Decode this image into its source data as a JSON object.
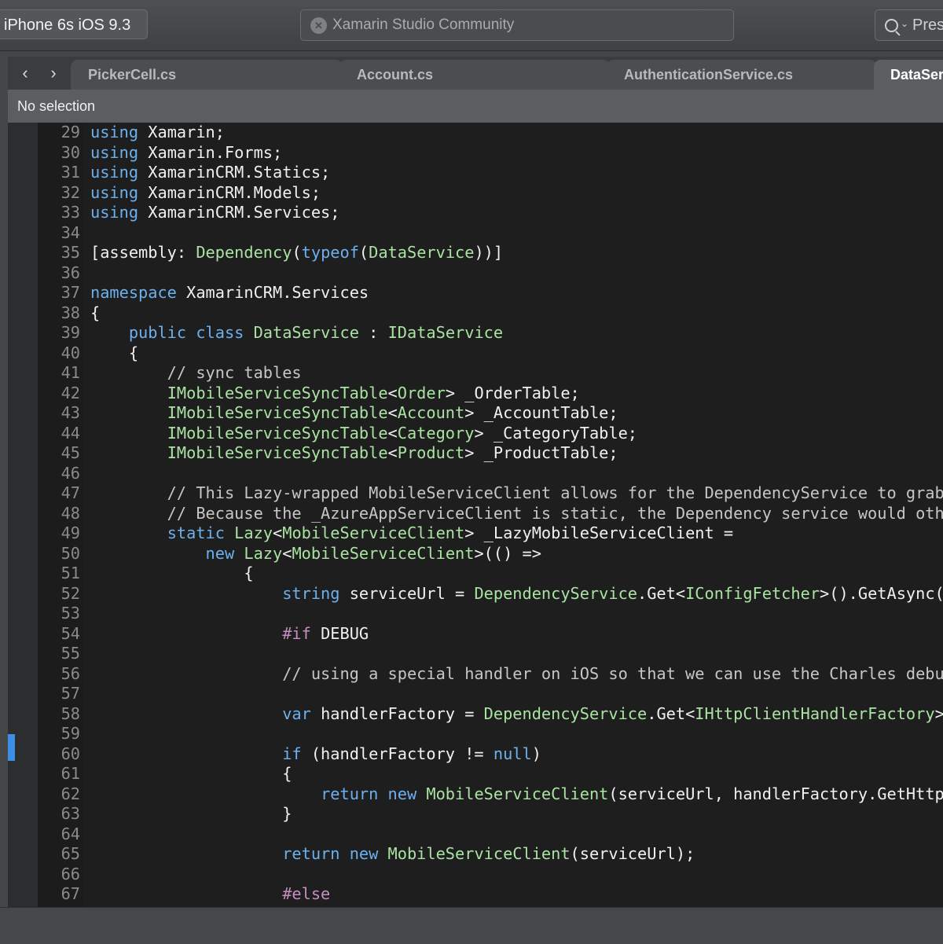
{
  "toolbar": {
    "device": "iPhone 6s iOS 9.3",
    "status": "Xamarin Studio Community",
    "search_placeholder": "Pres",
    "logo_icon": "xamarin-logo-icon"
  },
  "nav": {
    "back": "‹",
    "forward": "›"
  },
  "tabs": [
    {
      "label": "PickerCell.cs",
      "active": false
    },
    {
      "label": "Account.cs",
      "active": false
    },
    {
      "label": "AuthenticationService.cs",
      "active": false
    },
    {
      "label": "DataService.cs",
      "active": true
    }
  ],
  "breadcrumb": {
    "label": "No selection"
  },
  "colors": {
    "keyword": "#6cb0ee",
    "type": "#a9e3a2",
    "comment": "#c6c6c6",
    "preprocessor": "#c58ec2",
    "breakpoint_marker": "#3d8fe6"
  },
  "code": [
    {
      "n": "29",
      "tokens": [
        [
          "kw",
          "using"
        ],
        [
          "tx",
          " Xamarin;"
        ]
      ]
    },
    {
      "n": "30",
      "tokens": [
        [
          "kw",
          "using"
        ],
        [
          "tx",
          " Xamarin.Forms;"
        ]
      ]
    },
    {
      "n": "31",
      "tokens": [
        [
          "kw",
          "using"
        ],
        [
          "tx",
          " XamarinCRM.Statics;"
        ]
      ]
    },
    {
      "n": "32",
      "tokens": [
        [
          "kw",
          "using"
        ],
        [
          "tx",
          " XamarinCRM.Models;"
        ]
      ]
    },
    {
      "n": "33",
      "tokens": [
        [
          "kw",
          "using"
        ],
        [
          "tx",
          " XamarinCRM.Services;"
        ]
      ]
    },
    {
      "n": "34",
      "tokens": []
    },
    {
      "n": "35",
      "tokens": [
        [
          "tx",
          "[assembly: "
        ],
        [
          "ty",
          "Dependency"
        ],
        [
          "tx",
          "("
        ],
        [
          "kw",
          "typeof"
        ],
        [
          "tx",
          "("
        ],
        [
          "ty",
          "DataService"
        ],
        [
          "tx",
          "))]"
        ]
      ]
    },
    {
      "n": "36",
      "tokens": []
    },
    {
      "n": "37",
      "tokens": [
        [
          "kw",
          "namespace"
        ],
        [
          "tx",
          " XamarinCRM.Services"
        ]
      ]
    },
    {
      "n": "38",
      "tokens": [
        [
          "tx",
          "{"
        ]
      ]
    },
    {
      "n": "39",
      "tokens": [
        [
          "tx",
          "    "
        ],
        [
          "kw",
          "public class"
        ],
        [
          "tx",
          " "
        ],
        [
          "ty",
          "DataService"
        ],
        [
          "tx",
          " : "
        ],
        [
          "ty",
          "IDataService"
        ]
      ]
    },
    {
      "n": "40",
      "tokens": [
        [
          "tx",
          "    {"
        ]
      ]
    },
    {
      "n": "41",
      "tokens": [
        [
          "cm",
          "        // sync tables"
        ]
      ]
    },
    {
      "n": "42",
      "tokens": [
        [
          "tx",
          "        "
        ],
        [
          "ty",
          "IMobileServiceSyncTable"
        ],
        [
          "tx",
          "<"
        ],
        [
          "ty",
          "Order"
        ],
        [
          "tx",
          "> _OrderTable;"
        ]
      ]
    },
    {
      "n": "43",
      "tokens": [
        [
          "tx",
          "        "
        ],
        [
          "ty",
          "IMobileServiceSyncTable"
        ],
        [
          "tx",
          "<"
        ],
        [
          "ty",
          "Account"
        ],
        [
          "tx",
          "> _AccountTable;"
        ]
      ]
    },
    {
      "n": "44",
      "tokens": [
        [
          "tx",
          "        "
        ],
        [
          "ty",
          "IMobileServiceSyncTable"
        ],
        [
          "tx",
          "<"
        ],
        [
          "ty",
          "Category"
        ],
        [
          "tx",
          "> _CategoryTable;"
        ]
      ]
    },
    {
      "n": "45",
      "tokens": [
        [
          "tx",
          "        "
        ],
        [
          "ty",
          "IMobileServiceSyncTable"
        ],
        [
          "tx",
          "<"
        ],
        [
          "ty",
          "Product"
        ],
        [
          "tx",
          "> _ProductTable;"
        ]
      ]
    },
    {
      "n": "46",
      "tokens": []
    },
    {
      "n": "47",
      "tokens": [
        [
          "cm",
          "        // This Lazy-wrapped MobileServiceClient allows for the DependencyService to grab"
        ]
      ]
    },
    {
      "n": "48",
      "tokens": [
        [
          "cm",
          "        // Because the _AzureAppServiceClient is static, the Dependency service would oth"
        ]
      ]
    },
    {
      "n": "49",
      "tokens": [
        [
          "tx",
          "        "
        ],
        [
          "kw",
          "static"
        ],
        [
          "tx",
          " "
        ],
        [
          "ty",
          "Lazy"
        ],
        [
          "tx",
          "<"
        ],
        [
          "ty",
          "MobileServiceClient"
        ],
        [
          "tx",
          "> _LazyMobileServiceClient ="
        ]
      ]
    },
    {
      "n": "50",
      "tokens": [
        [
          "tx",
          "            "
        ],
        [
          "kw",
          "new"
        ],
        [
          "tx",
          " "
        ],
        [
          "ty",
          "Lazy"
        ],
        [
          "tx",
          "<"
        ],
        [
          "ty",
          "MobileServiceClient"
        ],
        [
          "tx",
          ">(() =>"
        ]
      ]
    },
    {
      "n": "51",
      "tokens": [
        [
          "tx",
          "                {"
        ]
      ]
    },
    {
      "n": "52",
      "tokens": [
        [
          "tx",
          "                    "
        ],
        [
          "kw",
          "string"
        ],
        [
          "tx",
          " serviceUrl = "
        ],
        [
          "ty",
          "DependencyService"
        ],
        [
          "tx",
          ".Get<"
        ],
        [
          "ty",
          "IConfigFetcher"
        ],
        [
          "tx",
          ">().GetAsync("
        ]
      ]
    },
    {
      "n": "53",
      "tokens": []
    },
    {
      "n": "54",
      "tokens": [
        [
          "tx",
          "                    "
        ],
        [
          "pp",
          "#if"
        ],
        [
          "tx",
          " DEBUG"
        ]
      ]
    },
    {
      "n": "55",
      "tokens": []
    },
    {
      "n": "56",
      "tokens": [
        [
          "cm",
          "                    // using a special handler on iOS so that we can use the Charles debu"
        ]
      ]
    },
    {
      "n": "57",
      "tokens": []
    },
    {
      "n": "58",
      "tokens": [
        [
          "tx",
          "                    "
        ],
        [
          "kw",
          "var"
        ],
        [
          "tx",
          " handlerFactory = "
        ],
        [
          "ty",
          "DependencyService"
        ],
        [
          "tx",
          ".Get<"
        ],
        [
          "ty",
          "IHttpClientHandlerFactory"
        ],
        [
          "tx",
          ">"
        ]
      ]
    },
    {
      "n": "59",
      "tokens": []
    },
    {
      "n": "60",
      "tokens": [
        [
          "tx",
          "                    "
        ],
        [
          "kw",
          "if"
        ],
        [
          "tx",
          " (handlerFactory != "
        ],
        [
          "kw",
          "null"
        ],
        [
          "tx",
          ")"
        ]
      ]
    },
    {
      "n": "61",
      "tokens": [
        [
          "tx",
          "                    {"
        ]
      ]
    },
    {
      "n": "62",
      "tokens": [
        [
          "tx",
          "                        "
        ],
        [
          "kw",
          "return new"
        ],
        [
          "tx",
          " "
        ],
        [
          "ty",
          "MobileServiceClient"
        ],
        [
          "tx",
          "(serviceUrl, handlerFactory.GetHttp"
        ]
      ]
    },
    {
      "n": "63",
      "tokens": [
        [
          "tx",
          "                    }"
        ]
      ]
    },
    {
      "n": "64",
      "tokens": []
    },
    {
      "n": "65",
      "tokens": [
        [
          "tx",
          "                    "
        ],
        [
          "kw",
          "return new"
        ],
        [
          "tx",
          " "
        ],
        [
          "ty",
          "MobileServiceClient"
        ],
        [
          "tx",
          "(serviceUrl);"
        ]
      ]
    },
    {
      "n": "66",
      "tokens": []
    },
    {
      "n": "67",
      "tokens": [
        [
          "tx",
          "                    "
        ],
        [
          "pp",
          "#else"
        ]
      ]
    }
  ]
}
